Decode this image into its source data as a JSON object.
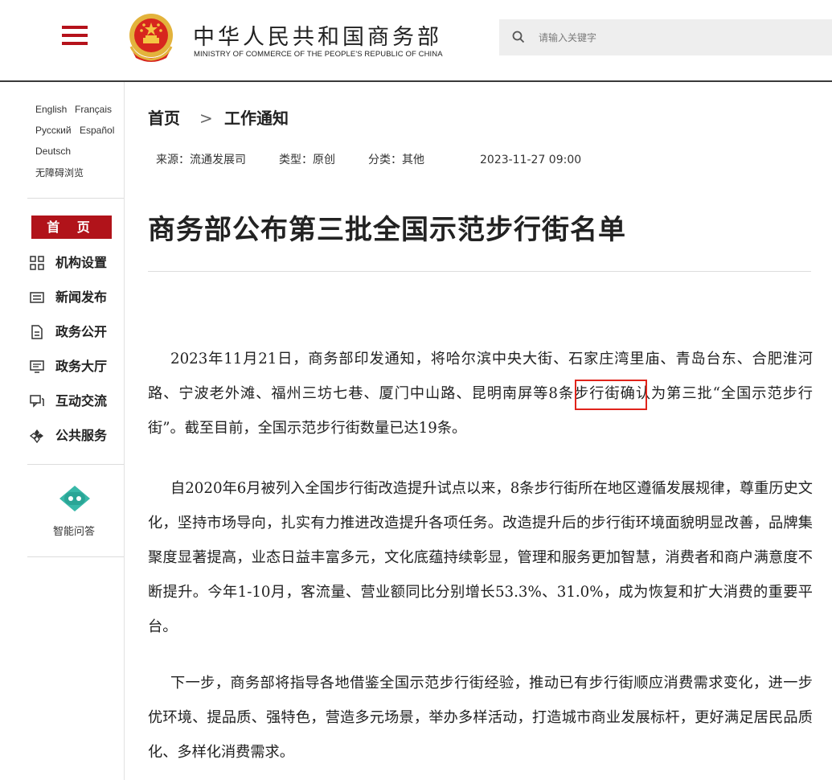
{
  "header": {
    "brand_cn": "中华人民共和国商务部",
    "brand_en": "MINISTRY OF COMMERCE OF THE PEOPLE'S REPUBLIC OF CHINA",
    "search_placeholder": "请输入关键字",
    "menu_icon": "hamburger-menu-icon",
    "search_icon": "search-icon",
    "emblem_icon": "national-emblem-icon"
  },
  "languages": {
    "english": "English",
    "french": "Français",
    "russian": "Русский",
    "spanish": "Español",
    "german": "Deutsch",
    "accessibility": "无障碍浏览"
  },
  "sidebar": {
    "home": "首 页",
    "items": [
      {
        "label": "机构设置",
        "icon": "org-grid-icon"
      },
      {
        "label": "新闻发布",
        "icon": "news-icon"
      },
      {
        "label": "政务公开",
        "icon": "document-icon"
      },
      {
        "label": "政务大厅",
        "icon": "hall-monitor-icon"
      },
      {
        "label": "互动交流",
        "icon": "chat-icon"
      },
      {
        "label": "公共服务",
        "icon": "service-icon"
      }
    ],
    "qa_label": "智能问答",
    "qa_icon": "robot-icon"
  },
  "breadcrumb": {
    "home": "首页",
    "separator": ">",
    "current": "工作通知"
  },
  "meta": {
    "source": "来源：流通发展司",
    "type": "类型：原创",
    "category": "分类：其他",
    "datetime": "2023-11-27 09:00"
  },
  "article": {
    "title": "商务部公布第三批全国示范步行街名单",
    "p1_before": "2023年11月21日，商务部印发通知，将哈尔滨中央大街、石家庄湾里庙、青岛台东、合肥淮河路、宁波老外滩、福州三坊七巷、厦门中山路、",
    "p1_highlight": "昆明南屏",
    "p1_after": "等8条步行街确认为第三批“全国示范步行街”。截至目前，全国示范步行街数量已达19条。",
    "p2": "自2020年6月被列入全国步行街改造提升试点以来，8条步行街所在地区遵循发展规律，尊重历史文化，坚持市场导向，扎实有力推进改造提升各项任务。改造提升后的步行街环境面貌明显改善，品牌集聚度显著提高，业态日益丰富多元，文化底蕴持续彰显，管理和服务更加智慧，消费者和商户满意度不断提升。今年1-10月，客流量、营业额同比分别增长53.3%、31.0%，成为恢复和扩大消费的重要平台。",
    "p3": "下一步，商务部将指导各地借鉴全国示范步行街经验，推动已有步行街顺应消费需求变化，进一步优环境、提品质、强特色，营造多元场景，举办多样活动，打造城市商业发展标杆，更好满足居民品质化、多样化消费需求。"
  },
  "colors": {
    "brand_red": "#b1131a",
    "highlight_box": "#e0241b",
    "header_rule": "#3a3a3a"
  }
}
